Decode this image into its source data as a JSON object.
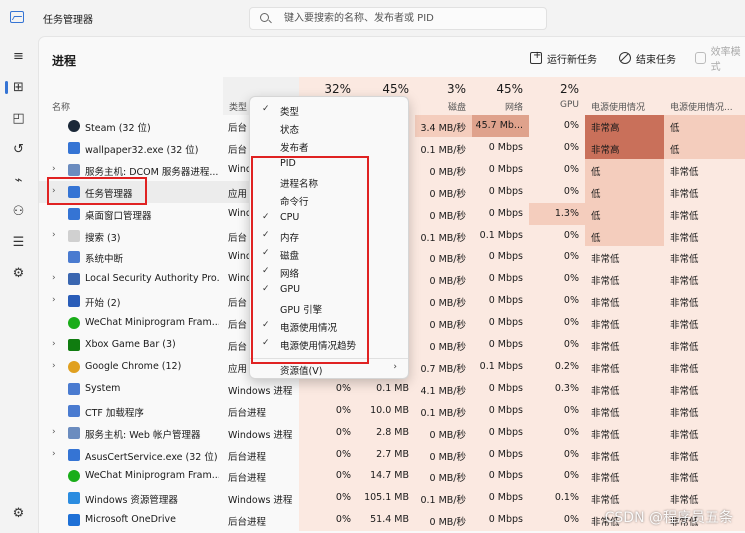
{
  "titlebar": {
    "title": "任务管理器",
    "search_placeholder": "键入要搜索的名称、发布者或 PID"
  },
  "page": {
    "title": "进程",
    "toolbar": {
      "new_task": "运行新任务",
      "end_task": "结束任务",
      "efficiency": "效率模式"
    }
  },
  "columns": {
    "name": "名称",
    "type": "类型",
    "cpu_pct": "32%",
    "cpu": "",
    "mem_pct": "45%",
    "mem": "",
    "disk_pct": "3%",
    "disk": "磁盘",
    "net_pct": "45%",
    "net": "网络",
    "gpu_pct": "2%",
    "gpu": "GPU",
    "power": "电源使用情况",
    "power_trend": "电源使用情况..."
  },
  "processes": [
    {
      "name": "Steam (32 位)",
      "type": "后台",
      "cpu": "",
      "mem": "",
      "disk": "3.4 MB/秒",
      "net": "45.7 Mb...",
      "gpu": "0%",
      "power": "非常高",
      "trend": "低",
      "icon": "steam-icon",
      "expandable": false
    },
    {
      "name": "wallpaper32.exe (32 位)",
      "type": "后台",
      "cpu": "",
      "mem": "",
      "disk": "0.1 MB/秒",
      "net": "0 Mbps",
      "gpu": "0%",
      "power": "非常高",
      "trend": "低",
      "icon": "wallpaper-icon",
      "expandable": false
    },
    {
      "name": "服务主机: DCOM 服务器进程...",
      "type": "Wind",
      "cpu": "",
      "mem": "",
      "disk": "0 MB/秒",
      "net": "0 Mbps",
      "gpu": "0%",
      "power": "低",
      "trend": "非常低",
      "icon": "service-host-icon",
      "expandable": true
    },
    {
      "name": "任务管理器",
      "type": "应用",
      "cpu": "",
      "mem": "",
      "disk": "0 MB/秒",
      "net": "0 Mbps",
      "gpu": "0%",
      "power": "低",
      "trend": "非常低",
      "icon": "task-manager-icon",
      "expandable": true
    },
    {
      "name": "桌面窗口管理器",
      "type": "Wind",
      "cpu": "",
      "mem": "",
      "disk": "0 MB/秒",
      "net": "0 Mbps",
      "gpu": "1.3%",
      "power": "低",
      "trend": "非常低",
      "icon": "dwm-icon",
      "expandable": false
    },
    {
      "name": "搜索 (3)",
      "type": "后台",
      "cpu": "",
      "mem": "",
      "disk": "0.1 MB/秒",
      "net": "0.1 Mbps",
      "gpu": "0%",
      "power": "低",
      "trend": "非常低",
      "icon": "search-app-icon",
      "expandable": true
    },
    {
      "name": "系统中断",
      "type": "Wind",
      "cpu": "",
      "mem": "",
      "disk": "0 MB/秒",
      "net": "0 Mbps",
      "gpu": "0%",
      "power": "非常低",
      "trend": "非常低",
      "icon": "system-icon",
      "expandable": false
    },
    {
      "name": "Local Security Authority Pro...",
      "type": "Wind",
      "cpu": "",
      "mem": "",
      "disk": "0 MB/秒",
      "net": "0 Mbps",
      "gpu": "0%",
      "power": "非常低",
      "trend": "非常低",
      "icon": "lsa-icon",
      "expandable": true
    },
    {
      "name": "开始 (2)",
      "type": "后台",
      "cpu": "",
      "mem": "",
      "disk": "0 MB/秒",
      "net": "0 Mbps",
      "gpu": "0%",
      "power": "非常低",
      "trend": "非常低",
      "icon": "start-icon",
      "expandable": true
    },
    {
      "name": "WeChat Miniprogram Fram...",
      "type": "后台",
      "cpu": "",
      "mem": "",
      "disk": "0 MB/秒",
      "net": "0 Mbps",
      "gpu": "0%",
      "power": "非常低",
      "trend": "非常低",
      "icon": "wechat-icon",
      "expandable": false
    },
    {
      "name": "Xbox Game Bar (3)",
      "type": "后台",
      "cpu": "",
      "mem": "",
      "disk": "0 MB/秒",
      "net": "0 Mbps",
      "gpu": "0%",
      "power": "非常低",
      "trend": "非常低",
      "icon": "xbox-icon",
      "expandable": true
    },
    {
      "name": "Google Chrome (12)",
      "type": "应用",
      "cpu": "",
      "mem": "",
      "disk": "0.7 MB/秒",
      "net": "0.1 Mbps",
      "gpu": "0.2%",
      "power": "非常低",
      "trend": "非常低",
      "icon": "chrome-icon",
      "expandable": true
    },
    {
      "name": "System",
      "type": "Windows 进程",
      "cpu": "0%",
      "mem": "0.1 MB",
      "disk": "4.1 MB/秒",
      "net": "0 Mbps",
      "gpu": "0.3%",
      "power": "非常低",
      "trend": "非常低",
      "icon": "system-process-icon",
      "expandable": false
    },
    {
      "name": "CTF 加载程序",
      "type": "后台进程",
      "cpu": "0%",
      "mem": "10.0 MB",
      "disk": "0.1 MB/秒",
      "net": "0 Mbps",
      "gpu": "0%",
      "power": "非常低",
      "trend": "非常低",
      "icon": "ctf-icon",
      "expandable": false
    },
    {
      "name": "服务主机: Web 帐户管理器",
      "type": "Windows 进程",
      "cpu": "0%",
      "mem": "2.8 MB",
      "disk": "0 MB/秒",
      "net": "0 Mbps",
      "gpu": "0%",
      "power": "非常低",
      "trend": "非常低",
      "icon": "service-host-icon",
      "expandable": true
    },
    {
      "name": "AsusCertService.exe (32 位)",
      "type": "后台进程",
      "cpu": "0%",
      "mem": "2.7 MB",
      "disk": "0 MB/秒",
      "net": "0 Mbps",
      "gpu": "0%",
      "power": "非常低",
      "trend": "非常低",
      "icon": "asus-icon",
      "expandable": true
    },
    {
      "name": "WeChat Miniprogram Fram...",
      "type": "后台进程",
      "cpu": "0%",
      "mem": "14.7 MB",
      "disk": "0 MB/秒",
      "net": "0 Mbps",
      "gpu": "0%",
      "power": "非常低",
      "trend": "非常低",
      "icon": "wechat-icon",
      "expandable": false
    },
    {
      "name": "Windows 资源管理器",
      "type": "Windows 进程",
      "cpu": "0%",
      "mem": "105.1 MB",
      "disk": "0.1 MB/秒",
      "net": "0 Mbps",
      "gpu": "0.1%",
      "power": "非常低",
      "trend": "非常低",
      "icon": "explorer-icon",
      "expandable": false
    },
    {
      "name": "Microsoft OneDrive",
      "type": "后台进程",
      "cpu": "0%",
      "mem": "51.4 MB",
      "disk": "0 MB/秒",
      "net": "0 Mbps",
      "gpu": "0%",
      "power": "非常低",
      "trend": "非常低",
      "icon": "onedrive-icon",
      "expandable": false
    }
  ],
  "context_menu": [
    {
      "label": "类型",
      "checked": true
    },
    {
      "label": "状态",
      "checked": false
    },
    {
      "label": "发布者",
      "checked": false
    },
    {
      "label": "PID",
      "checked": false
    },
    {
      "label": "进程名称",
      "checked": false
    },
    {
      "label": "命令行",
      "checked": false
    },
    {
      "label": "CPU",
      "checked": true
    },
    {
      "label": "内存",
      "checked": true
    },
    {
      "label": "磁盘",
      "checked": true
    },
    {
      "label": "网络",
      "checked": true
    },
    {
      "label": "GPU",
      "checked": true
    },
    {
      "label": "GPU 引擎",
      "checked": false
    },
    {
      "label": "电源使用情况",
      "checked": true
    },
    {
      "label": "电源使用情况趋势",
      "checked": true
    },
    {
      "label": "资源值(V)",
      "checked": false,
      "submenu": true
    }
  ],
  "watermark": "CSDN @程序员五条",
  "colors": {
    "accent": "#3574d4",
    "highlight_red": "#e02222",
    "heat_light": "#fbe9e1",
    "heat_mid": "#f4cdbd",
    "heat_high": "#dfa28c",
    "heat_very_high": "#c9705a"
  }
}
